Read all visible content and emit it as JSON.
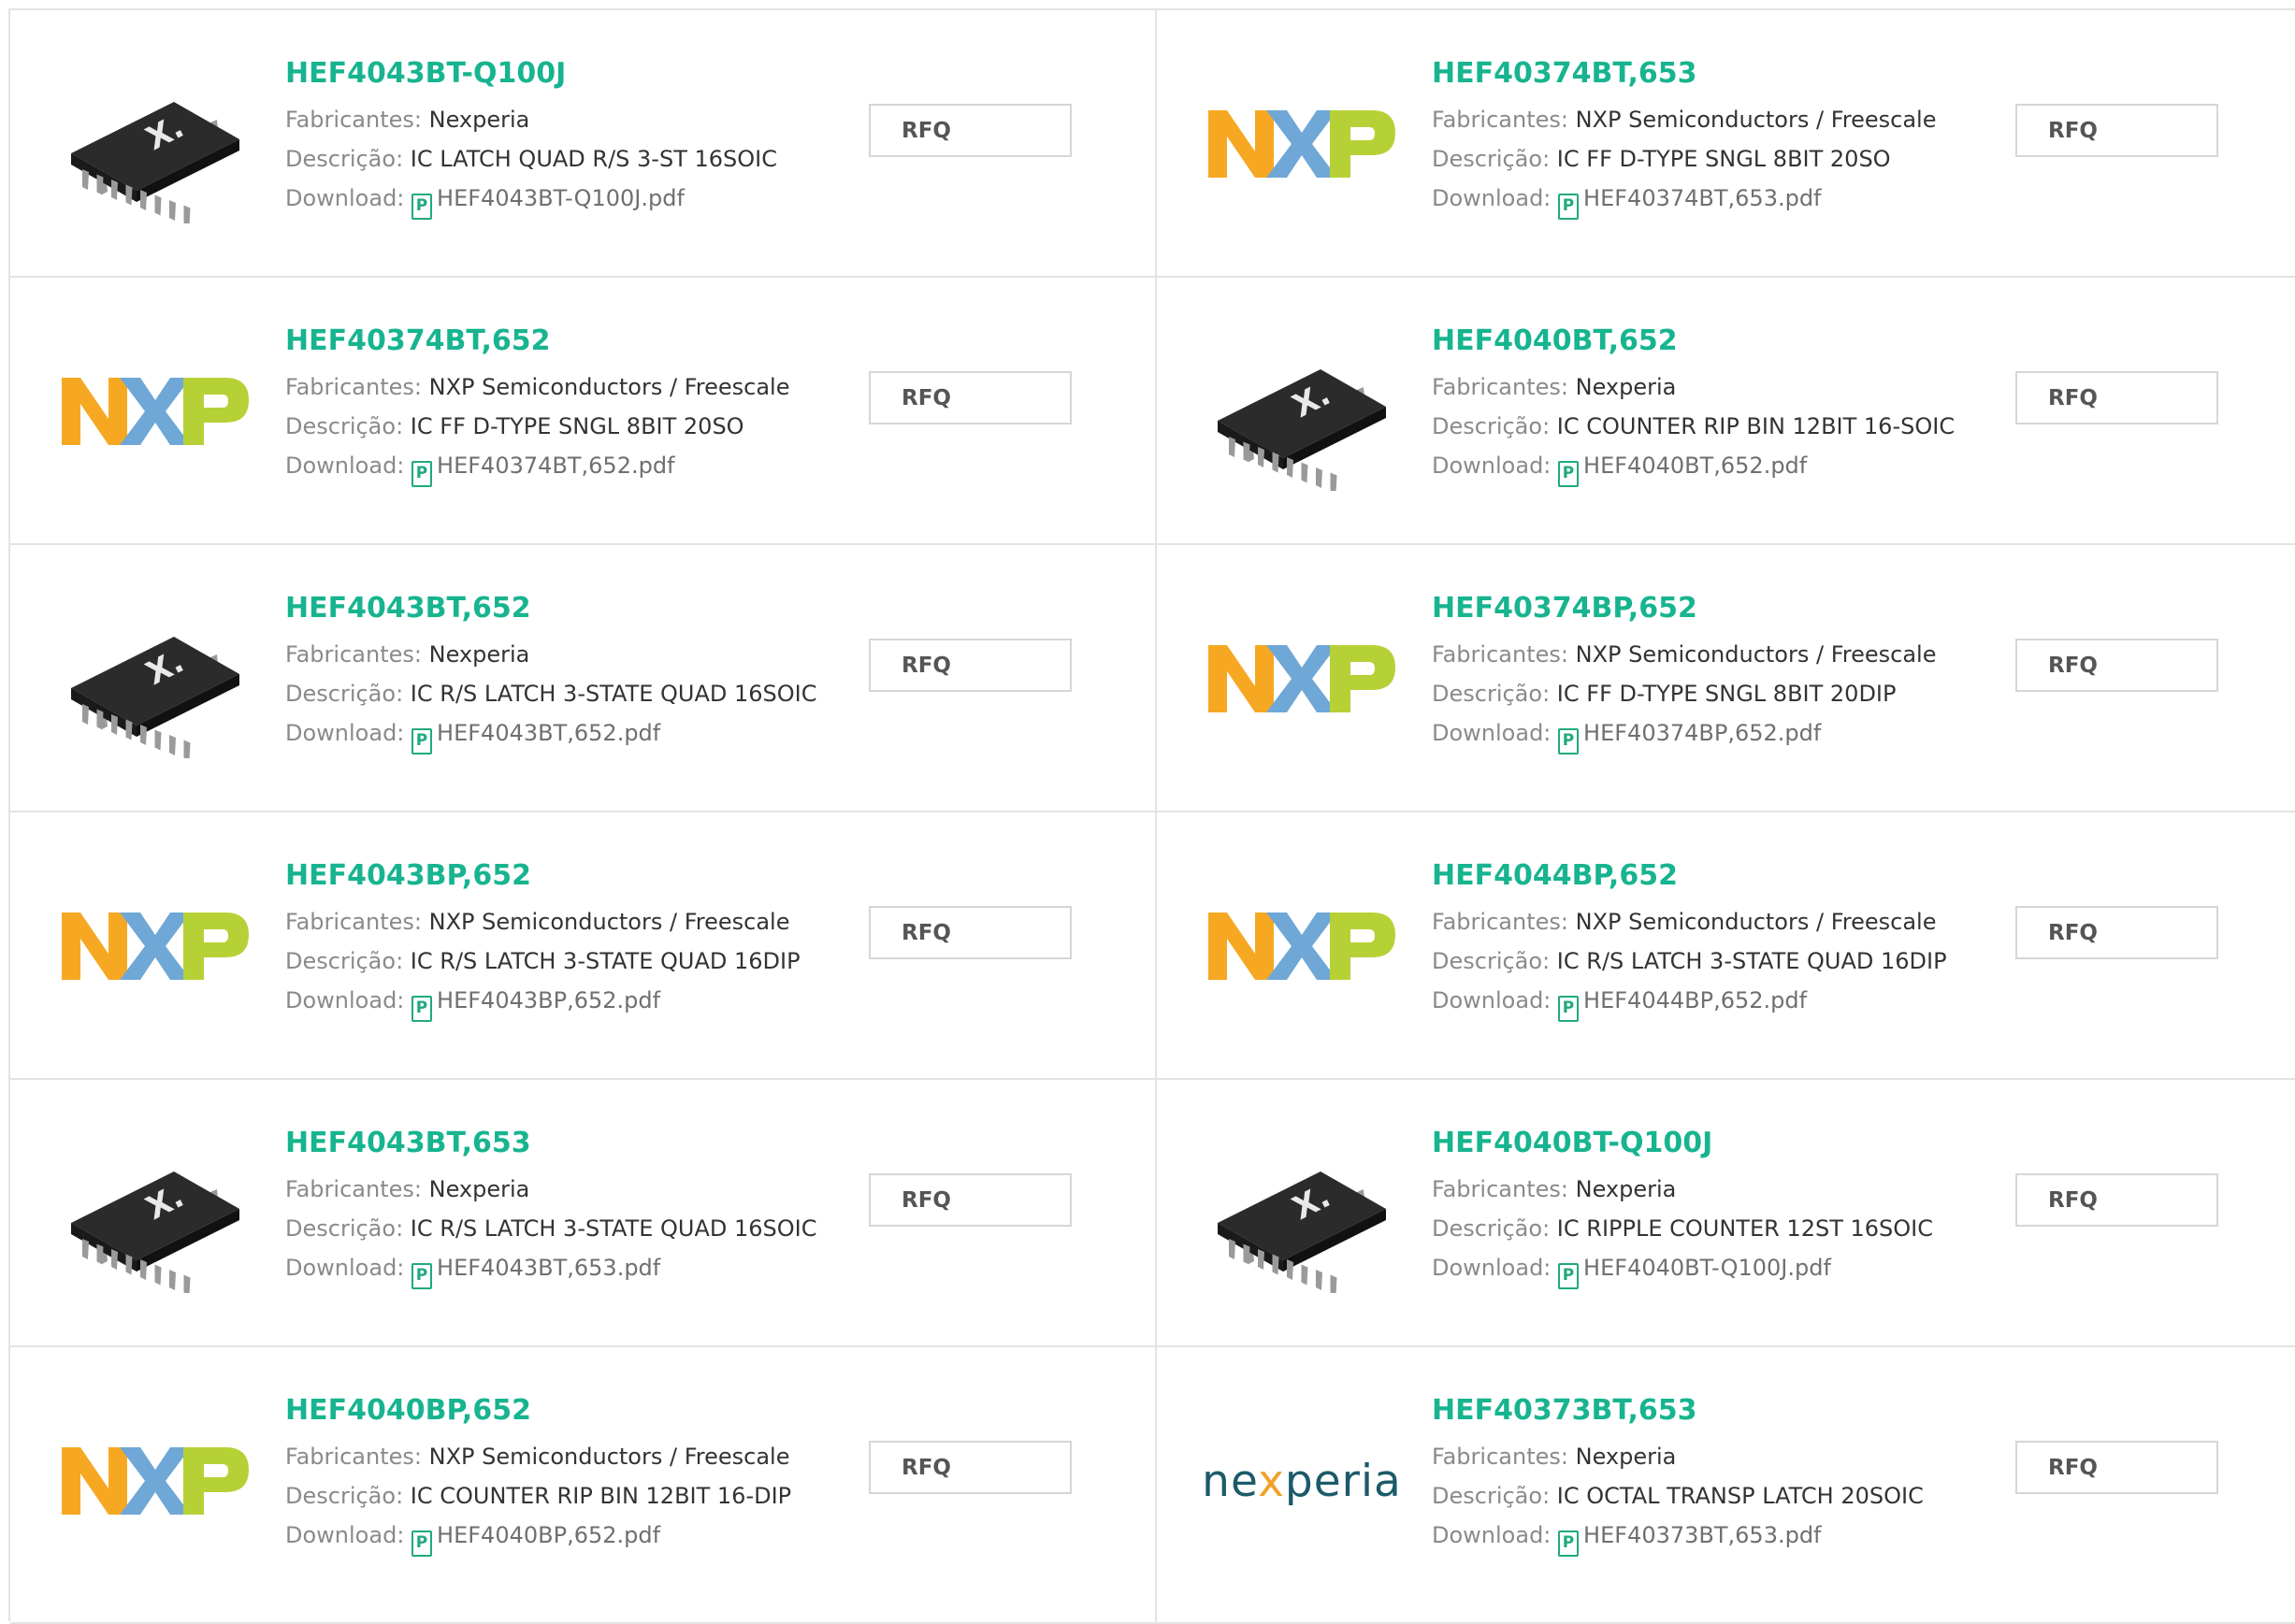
{
  "labels": {
    "manufacturer": "Fabricantes:",
    "description": "Descrição:",
    "download": "Download:",
    "rfq": "RFQ",
    "pdf_icon": "P"
  },
  "products": [
    {
      "name": "HEF4043BT-Q100J",
      "manufacturer": "Nexperia",
      "description": "IC LATCH QUAD R/S 3-ST 16SOIC",
      "file": "HEF4043BT-Q100J.pdf",
      "image": "ic-chip"
    },
    {
      "name": "HEF40374BT,653",
      "manufacturer": "NXP Semiconductors / Freescale",
      "description": "IC FF D-TYPE SNGL 8BIT 20SO",
      "file": "HEF40374BT,653.pdf",
      "image": "nxp-logo"
    },
    {
      "name": "HEF40374BT,652",
      "manufacturer": "NXP Semiconductors / Freescale",
      "description": "IC FF D-TYPE SNGL 8BIT 20SO",
      "file": "HEF40374BT,652.pdf",
      "image": "nxp-logo"
    },
    {
      "name": "HEF4040BT,652",
      "manufacturer": "Nexperia",
      "description": "IC COUNTER RIP BIN 12BIT 16-SOIC",
      "file": "HEF4040BT,652.pdf",
      "image": "ic-chip"
    },
    {
      "name": "HEF4043BT,652",
      "manufacturer": "Nexperia",
      "description": "IC R/S LATCH 3-STATE QUAD 16SOIC",
      "file": "HEF4043BT,652.pdf",
      "image": "ic-chip"
    },
    {
      "name": "HEF40374BP,652",
      "manufacturer": "NXP Semiconductors / Freescale",
      "description": "IC FF D-TYPE SNGL 8BIT 20DIP",
      "file": "HEF40374BP,652.pdf",
      "image": "nxp-logo"
    },
    {
      "name": "HEF4043BP,652",
      "manufacturer": "NXP Semiconductors / Freescale",
      "description": "IC R/S LATCH 3-STATE QUAD 16DIP",
      "file": "HEF4043BP,652.pdf",
      "image": "nxp-logo"
    },
    {
      "name": "HEF4044BP,652",
      "manufacturer": "NXP Semiconductors / Freescale",
      "description": "IC R/S LATCH 3-STATE QUAD 16DIP",
      "file": "HEF4044BP,652.pdf",
      "image": "nxp-logo"
    },
    {
      "name": "HEF4043BT,653",
      "manufacturer": "Nexperia",
      "description": "IC R/S LATCH 3-STATE QUAD 16SOIC",
      "file": "HEF4043BT,653.pdf",
      "image": "ic-chip"
    },
    {
      "name": "HEF4040BT-Q100J",
      "manufacturer": "Nexperia",
      "description": "IC RIPPLE COUNTER 12ST 16SOIC",
      "file": "HEF4040BT-Q100J.pdf",
      "image": "ic-chip"
    },
    {
      "name": "HEF4040BP,652",
      "manufacturer": "NXP Semiconductors / Freescale",
      "description": "IC COUNTER RIP BIN 12BIT 16-DIP",
      "file": "HEF4040BP,652.pdf",
      "image": "nxp-logo"
    },
    {
      "name": "HEF40373BT,653",
      "manufacturer": "Nexperia",
      "description": "IC OCTAL TRANSP LATCH 20SOIC",
      "file": "HEF40373BT,653.pdf",
      "image": "nexperia-logo",
      "logo_text": "nexperia"
    }
  ],
  "colors": {
    "product_link": "#17b48f",
    "border": "#e3e3e3",
    "nxp_orange": "#f7a823",
    "nxp_blue": "#6fa7d6",
    "nxp_green": "#b6d136",
    "nexperia_teal": "#1b5a6a"
  }
}
